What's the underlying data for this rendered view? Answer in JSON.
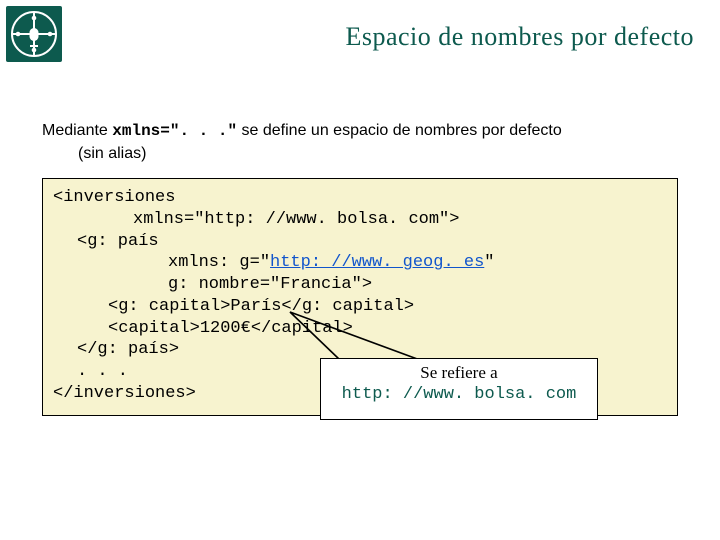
{
  "header": {
    "title": "Espacio de nombres por defecto"
  },
  "intro": {
    "pre": "Mediante ",
    "code": "xmlns=\". . .\"",
    "post": " se define un espacio de nombres por defecto",
    "line2": "(sin alias)"
  },
  "code": {
    "l1": "<inversiones",
    "l2": "xmlns=\"http: //www. bolsa. com\">",
    "l3": "<g: país",
    "l4a": "xmlns: g=\"",
    "l4link": "http: //www. geog. es",
    "l4b": "\"",
    "l5": "g: nombre=\"Francia\">",
    "l6": "<g: capital>París</g: capital>",
    "l7": "<capital>1200€</capital>",
    "l8": "</g: país>",
    "l9": ". . .",
    "l10": "</inversiones>"
  },
  "callout": {
    "line1": "Se refiere a",
    "line2": "http: //www. bolsa. com"
  }
}
